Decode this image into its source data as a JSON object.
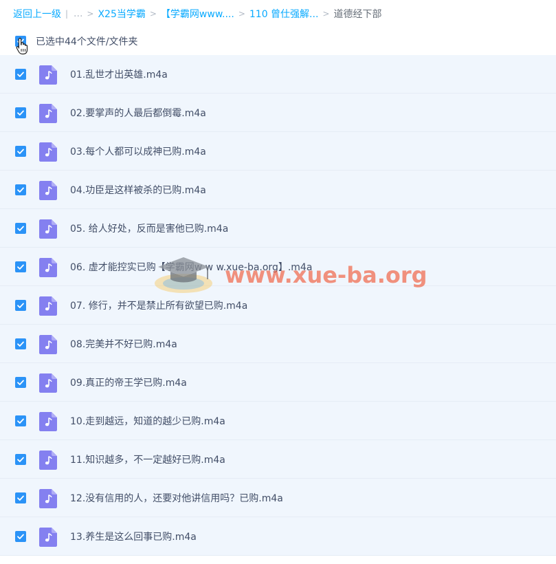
{
  "breadcrumb": {
    "back": "返回上一级",
    "separator": "|",
    "ellipsis": "...",
    "items": [
      "X25当学霸",
      "【学霸网www....",
      "110 曾仕强解..."
    ],
    "current": "道德经下部"
  },
  "selection": {
    "label": "已选中44个文件/文件夹"
  },
  "files": [
    {
      "name": "01.乱世才出英雄.m4a"
    },
    {
      "name": "02.要掌声的人最后都倒霉.m4a"
    },
    {
      "name": "03.每个人都可以成神已购.m4a"
    },
    {
      "name": "04.功臣是这样被杀的已购.m4a"
    },
    {
      "name": "05. 给人好处，反而是害他已购.m4a"
    },
    {
      "name": "06. 虚才能控实已购【学霸网w w w.xue-ba.org】.m4a"
    },
    {
      "name": "07. 修行，并不是禁止所有欲望已购.m4a"
    },
    {
      "name": "08.完美并不好已购.m4a"
    },
    {
      "name": "09.真正的帝王学已购.m4a"
    },
    {
      "name": "10.走到越远，知道的越少已购.m4a"
    },
    {
      "name": "11.知识越多，不一定越好已购.m4a"
    },
    {
      "name": "12.没有信用的人，还要对他讲信用吗？已购.m4a"
    },
    {
      "name": "13.养生是这么回事已购.m4a"
    }
  ],
  "watermark": {
    "text": "www.xue-ba.org"
  },
  "colors": {
    "accent": "#2b93f7",
    "link": "#09aaff",
    "file_icon": "#8480f0",
    "row_bg": "#f0f6fd",
    "watermark": "#f15a3a"
  },
  "icons": {
    "file": "audio-file-icon",
    "checkbox": "checkmark-icon",
    "cursor": "hand-pointer-icon"
  }
}
